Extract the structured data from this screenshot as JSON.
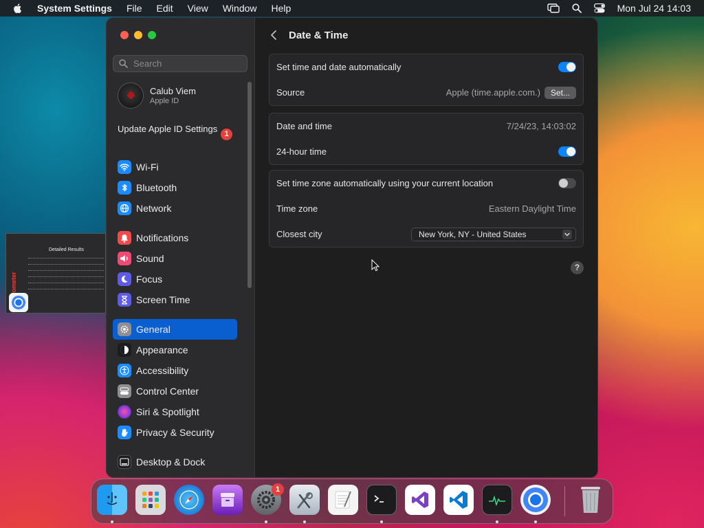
{
  "menubar": {
    "app": "System Settings",
    "items": [
      "File",
      "Edit",
      "View",
      "Window",
      "Help"
    ],
    "clock": "Mon Jul 24  14:03"
  },
  "thumbnail": {
    "title": "Detailed Results",
    "vertical_label": "edometer"
  },
  "sidebar": {
    "search_placeholder": "Search",
    "account": {
      "name": "Calub Viem",
      "sub": "Apple ID"
    },
    "update": {
      "label": "Update Apple ID Settings",
      "badge": "1"
    },
    "items": [
      {
        "label": "Wi-Fi",
        "icon": "wifi-icon",
        "color": "#1a8cff"
      },
      {
        "label": "Bluetooth",
        "icon": "bluetooth-icon",
        "color": "#1a8cff"
      },
      {
        "label": "Network",
        "icon": "globe-icon",
        "color": "#1a8cff"
      },
      {
        "label": "Notifications",
        "icon": "bell-icon",
        "color": "#f04a4a"
      },
      {
        "label": "Sound",
        "icon": "speaker-icon",
        "color": "#f04a72"
      },
      {
        "label": "Focus",
        "icon": "moon-icon",
        "color": "#5e5ce6"
      },
      {
        "label": "Screen Time",
        "icon": "hourglass-icon",
        "color": "#5e5ce6"
      },
      {
        "label": "General",
        "icon": "gear-icon",
        "color": "#8e8e93"
      },
      {
        "label": "Appearance",
        "icon": "appearance-icon",
        "color": "#1c1c1e"
      },
      {
        "label": "Accessibility",
        "icon": "accessibility-icon",
        "color": "#1a8cff"
      },
      {
        "label": "Control Center",
        "icon": "control-center-icon",
        "color": "#8e8e93"
      },
      {
        "label": "Siri & Spotlight",
        "icon": "siri-icon",
        "color": "#b24bd6"
      },
      {
        "label": "Privacy & Security",
        "icon": "hand-icon",
        "color": "#1a8cff"
      },
      {
        "label": "Desktop & Dock",
        "icon": "dock-icon",
        "color": "#1c1c1e"
      }
    ]
  },
  "content": {
    "title": "Date & Time",
    "group1": {
      "auto_label": "Set time and date automatically",
      "source_label": "Source",
      "source_value": "Apple (time.apple.com.)",
      "set_button": "Set..."
    },
    "group2": {
      "datetime_label": "Date and time",
      "datetime_value": "7/24/23, 14:03:02",
      "hour24_label": "24-hour time"
    },
    "group3": {
      "tz_auto_label": "Set time zone automatically using your current location",
      "tz_label": "Time zone",
      "tz_value": "Eastern Daylight Time",
      "city_label": "Closest city",
      "city_value": "New York, NY - United States"
    },
    "help": "?"
  },
  "dock": {
    "settings_badge": "1"
  }
}
